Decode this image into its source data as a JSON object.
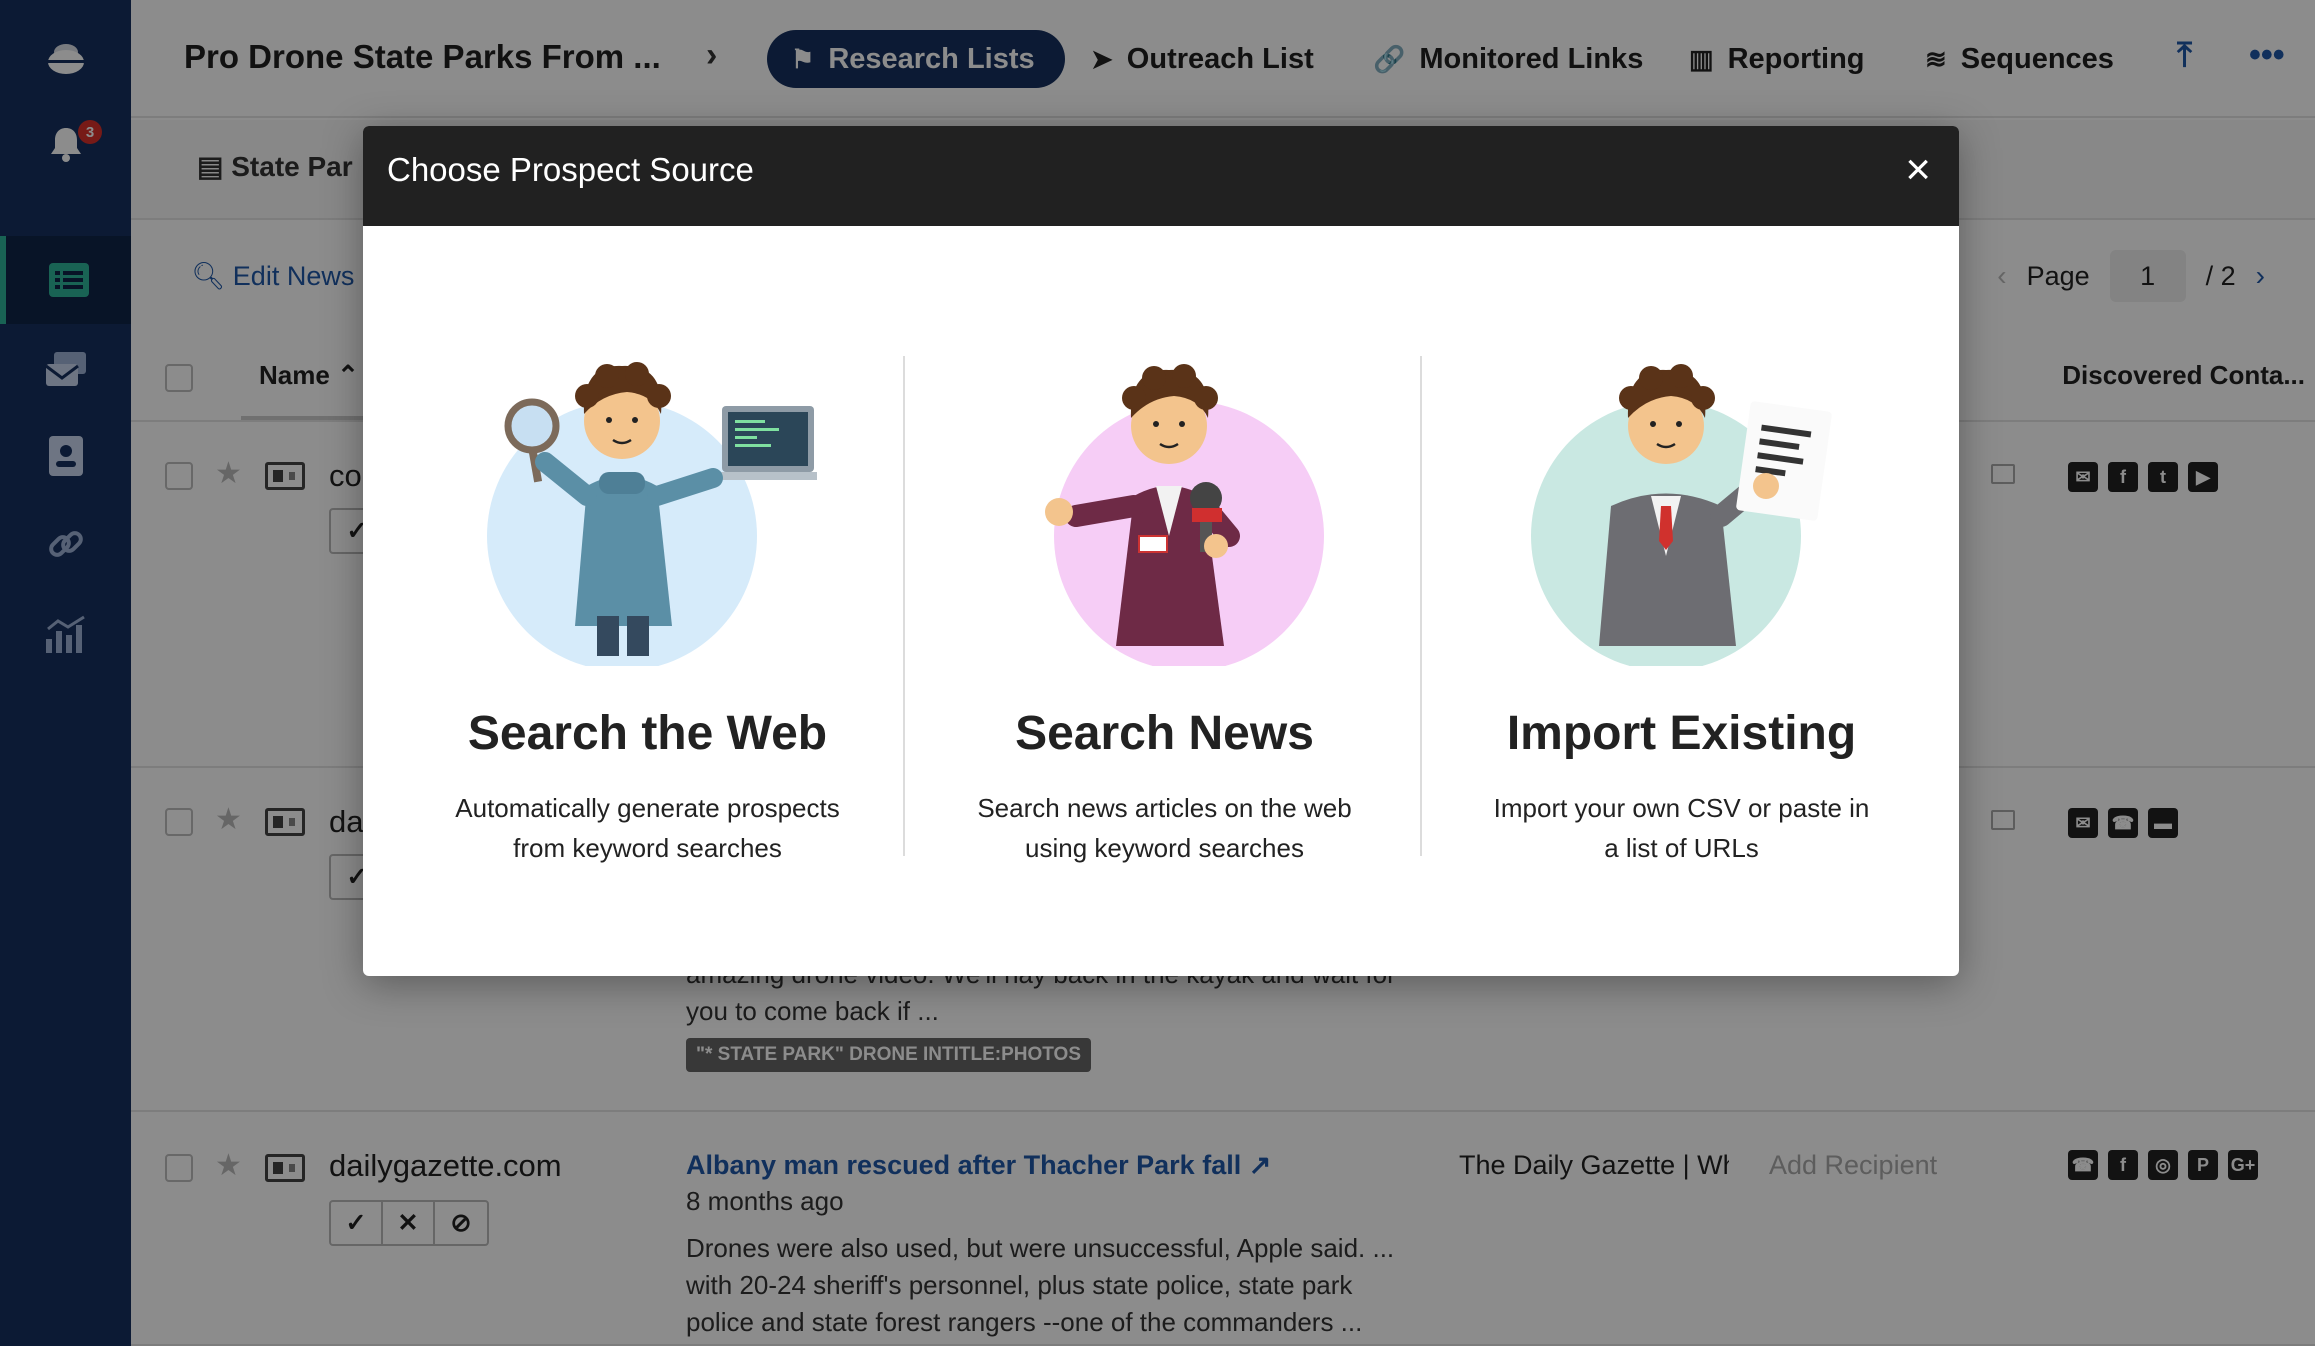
{
  "sidebar": {
    "notification_count": "3"
  },
  "topbar": {
    "project_title": "Pro Drone State Parks From ...",
    "nav": [
      {
        "label": "Research Lists",
        "icon": "flag-icon",
        "active": true
      },
      {
        "label": "Outreach List",
        "icon": "paper-plane-icon"
      },
      {
        "label": "Monitored Links",
        "icon": "link-icon"
      },
      {
        "label": "Reporting",
        "icon": "bar-chart-icon"
      },
      {
        "label": "Sequences",
        "icon": "layers-icon"
      }
    ]
  },
  "subbar": {
    "tab_label": "State Par"
  },
  "toolbar": {
    "edit_news_label": "Edit News",
    "page_label": "Page",
    "page_current": "1",
    "page_total": "/ 2"
  },
  "table": {
    "col_name": "Name",
    "col_discovered": "Discovered Conta...",
    "rows": [
      {
        "domain": "co"
      },
      {
        "domain": "da",
        "snippet": "amazing drone video. We'll nay back in the kayak and wait for you to come back if ...",
        "tag": "\"* STATE PARK\" DRONE INTITLE:PHOTOS"
      },
      {
        "domain": "dailygazette.com",
        "headline": "Albany man rescued after Thacher Park fall",
        "age": "8 months ago",
        "snippet": "Drones were also used, but were unsuccessful, Apple said. ... with 20-24 sheriff's personnel, plus state police, state park police and state forest rangers --one of the commanders ...",
        "publication": "The Daily Gazette | Wh",
        "recipient_placeholder": "Add Recipient"
      }
    ]
  },
  "modal": {
    "title": "Choose Prospect Source",
    "close_label": "×",
    "options": [
      {
        "title": "Search the Web",
        "desc_line1": "Automatically generate prospects",
        "desc_line2": "from keyword searches",
        "circle_color": "#d6ebfa"
      },
      {
        "title": "Search News",
        "desc_line1": "Search news articles on the web",
        "desc_line2": "using keyword searches",
        "circle_color": "#f6cdf6"
      },
      {
        "title": "Import Existing",
        "desc_line1": "Import your own CSV or paste in",
        "desc_line2": "a list of URLs",
        "circle_color": "#c9e8e2"
      }
    ]
  },
  "colors": {
    "sidebar": "#16305f",
    "accent": "#1f58a8",
    "active_marker": "#2fb59a",
    "modal_header": "#212121"
  }
}
